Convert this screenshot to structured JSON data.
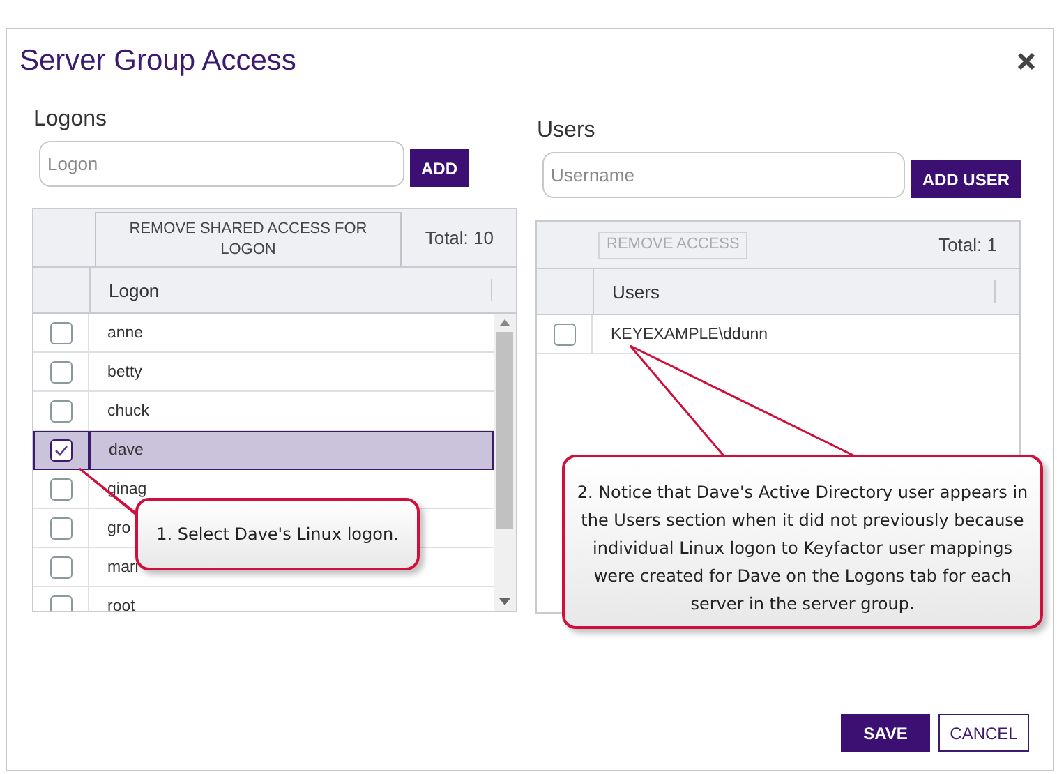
{
  "dialog": {
    "title": "Server Group Access"
  },
  "logons": {
    "label": "Logons",
    "placeholder": "Logon",
    "add_button": "ADD",
    "remove_button": "REMOVE SHARED ACCESS FOR LOGON",
    "remove_disabled": false,
    "total": "Total: 10",
    "column": "Logon",
    "rows": [
      {
        "name": "anne",
        "checked": false,
        "selected": false
      },
      {
        "name": "betty",
        "checked": false,
        "selected": false
      },
      {
        "name": "chuck",
        "checked": false,
        "selected": false
      },
      {
        "name": "dave",
        "checked": true,
        "selected": true
      },
      {
        "name": "ginag",
        "checked": false,
        "selected": false
      },
      {
        "name": "gro",
        "checked": false,
        "selected": false
      },
      {
        "name": "mari",
        "checked": false,
        "selected": false
      },
      {
        "name": "root",
        "checked": false,
        "selected": false
      }
    ]
  },
  "users": {
    "label": "Users",
    "placeholder": "Username",
    "add_button": "ADD USER",
    "remove_button": "REMOVE ACCESS",
    "remove_disabled": true,
    "total": "Total: 1",
    "column": "Users",
    "rows": [
      {
        "name": "KEYEXAMPLE\\ddunn",
        "checked": false,
        "selected": false
      }
    ]
  },
  "buttons": {
    "save": "SAVE",
    "cancel": "CANCEL"
  },
  "callouts": [
    {
      "text": "1. Select Dave's Linux logon."
    },
    {
      "text": "2. Notice that Dave's Active Directory user appears in the Users section when it did not previously because individual Linux logon to Keyfactor user mappings were created for Dave on the Logons tab for each server in the server group."
    }
  ]
}
